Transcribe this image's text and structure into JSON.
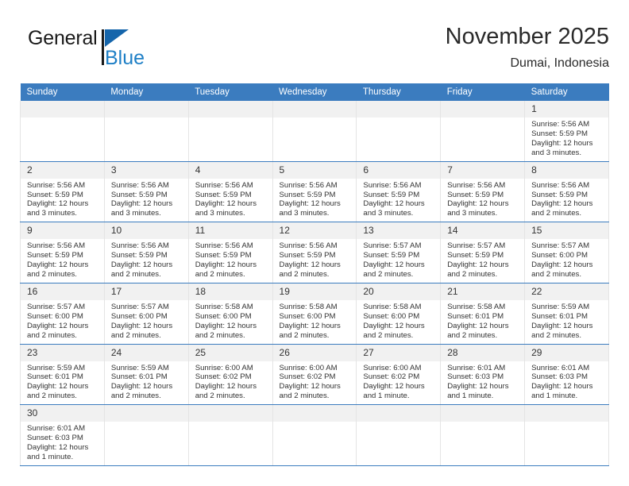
{
  "brand": {
    "name_top": "General",
    "name_bottom": "Blue",
    "accent_color": "#1e7fc6",
    "triangle_color": "#1565ab"
  },
  "header": {
    "title": "November 2025",
    "subtitle": "Dumai, Indonesia"
  },
  "theme": {
    "header_blue": "#3b7cbf",
    "daynum_band": "#f1f1f1",
    "cell_border": "#e4e4e4",
    "text": "#333333"
  },
  "weekdays": [
    "Sunday",
    "Monday",
    "Tuesday",
    "Wednesday",
    "Thursday",
    "Friday",
    "Saturday"
  ],
  "weeks": [
    [
      {
        "day": "",
        "sunrise": "",
        "sunset": "",
        "daylight": ""
      },
      {
        "day": "",
        "sunrise": "",
        "sunset": "",
        "daylight": ""
      },
      {
        "day": "",
        "sunrise": "",
        "sunset": "",
        "daylight": ""
      },
      {
        "day": "",
        "sunrise": "",
        "sunset": "",
        "daylight": ""
      },
      {
        "day": "",
        "sunrise": "",
        "sunset": "",
        "daylight": ""
      },
      {
        "day": "",
        "sunrise": "",
        "sunset": "",
        "daylight": ""
      },
      {
        "day": "1",
        "sunrise": "Sunrise: 5:56 AM",
        "sunset": "Sunset: 5:59 PM",
        "daylight": "Daylight: 12 hours and 3 minutes."
      }
    ],
    [
      {
        "day": "2",
        "sunrise": "Sunrise: 5:56 AM",
        "sunset": "Sunset: 5:59 PM",
        "daylight": "Daylight: 12 hours and 3 minutes."
      },
      {
        "day": "3",
        "sunrise": "Sunrise: 5:56 AM",
        "sunset": "Sunset: 5:59 PM",
        "daylight": "Daylight: 12 hours and 3 minutes."
      },
      {
        "day": "4",
        "sunrise": "Sunrise: 5:56 AM",
        "sunset": "Sunset: 5:59 PM",
        "daylight": "Daylight: 12 hours and 3 minutes."
      },
      {
        "day": "5",
        "sunrise": "Sunrise: 5:56 AM",
        "sunset": "Sunset: 5:59 PM",
        "daylight": "Daylight: 12 hours and 3 minutes."
      },
      {
        "day": "6",
        "sunrise": "Sunrise: 5:56 AM",
        "sunset": "Sunset: 5:59 PM",
        "daylight": "Daylight: 12 hours and 3 minutes."
      },
      {
        "day": "7",
        "sunrise": "Sunrise: 5:56 AM",
        "sunset": "Sunset: 5:59 PM",
        "daylight": "Daylight: 12 hours and 3 minutes."
      },
      {
        "day": "8",
        "sunrise": "Sunrise: 5:56 AM",
        "sunset": "Sunset: 5:59 PM",
        "daylight": "Daylight: 12 hours and 2 minutes."
      }
    ],
    [
      {
        "day": "9",
        "sunrise": "Sunrise: 5:56 AM",
        "sunset": "Sunset: 5:59 PM",
        "daylight": "Daylight: 12 hours and 2 minutes."
      },
      {
        "day": "10",
        "sunrise": "Sunrise: 5:56 AM",
        "sunset": "Sunset: 5:59 PM",
        "daylight": "Daylight: 12 hours and 2 minutes."
      },
      {
        "day": "11",
        "sunrise": "Sunrise: 5:56 AM",
        "sunset": "Sunset: 5:59 PM",
        "daylight": "Daylight: 12 hours and 2 minutes."
      },
      {
        "day": "12",
        "sunrise": "Sunrise: 5:56 AM",
        "sunset": "Sunset: 5:59 PM",
        "daylight": "Daylight: 12 hours and 2 minutes."
      },
      {
        "day": "13",
        "sunrise": "Sunrise: 5:57 AM",
        "sunset": "Sunset: 5:59 PM",
        "daylight": "Daylight: 12 hours and 2 minutes."
      },
      {
        "day": "14",
        "sunrise": "Sunrise: 5:57 AM",
        "sunset": "Sunset: 5:59 PM",
        "daylight": "Daylight: 12 hours and 2 minutes."
      },
      {
        "day": "15",
        "sunrise": "Sunrise: 5:57 AM",
        "sunset": "Sunset: 6:00 PM",
        "daylight": "Daylight: 12 hours and 2 minutes."
      }
    ],
    [
      {
        "day": "16",
        "sunrise": "Sunrise: 5:57 AM",
        "sunset": "Sunset: 6:00 PM",
        "daylight": "Daylight: 12 hours and 2 minutes."
      },
      {
        "day": "17",
        "sunrise": "Sunrise: 5:57 AM",
        "sunset": "Sunset: 6:00 PM",
        "daylight": "Daylight: 12 hours and 2 minutes."
      },
      {
        "day": "18",
        "sunrise": "Sunrise: 5:58 AM",
        "sunset": "Sunset: 6:00 PM",
        "daylight": "Daylight: 12 hours and 2 minutes."
      },
      {
        "day": "19",
        "sunrise": "Sunrise: 5:58 AM",
        "sunset": "Sunset: 6:00 PM",
        "daylight": "Daylight: 12 hours and 2 minutes."
      },
      {
        "day": "20",
        "sunrise": "Sunrise: 5:58 AM",
        "sunset": "Sunset: 6:00 PM",
        "daylight": "Daylight: 12 hours and 2 minutes."
      },
      {
        "day": "21",
        "sunrise": "Sunrise: 5:58 AM",
        "sunset": "Sunset: 6:01 PM",
        "daylight": "Daylight: 12 hours and 2 minutes."
      },
      {
        "day": "22",
        "sunrise": "Sunrise: 5:59 AM",
        "sunset": "Sunset: 6:01 PM",
        "daylight": "Daylight: 12 hours and 2 minutes."
      }
    ],
    [
      {
        "day": "23",
        "sunrise": "Sunrise: 5:59 AM",
        "sunset": "Sunset: 6:01 PM",
        "daylight": "Daylight: 12 hours and 2 minutes."
      },
      {
        "day": "24",
        "sunrise": "Sunrise: 5:59 AM",
        "sunset": "Sunset: 6:01 PM",
        "daylight": "Daylight: 12 hours and 2 minutes."
      },
      {
        "day": "25",
        "sunrise": "Sunrise: 6:00 AM",
        "sunset": "Sunset: 6:02 PM",
        "daylight": "Daylight: 12 hours and 2 minutes."
      },
      {
        "day": "26",
        "sunrise": "Sunrise: 6:00 AM",
        "sunset": "Sunset: 6:02 PM",
        "daylight": "Daylight: 12 hours and 2 minutes."
      },
      {
        "day": "27",
        "sunrise": "Sunrise: 6:00 AM",
        "sunset": "Sunset: 6:02 PM",
        "daylight": "Daylight: 12 hours and 1 minute."
      },
      {
        "day": "28",
        "sunrise": "Sunrise: 6:01 AM",
        "sunset": "Sunset: 6:03 PM",
        "daylight": "Daylight: 12 hours and 1 minute."
      },
      {
        "day": "29",
        "sunrise": "Sunrise: 6:01 AM",
        "sunset": "Sunset: 6:03 PM",
        "daylight": "Daylight: 12 hours and 1 minute."
      }
    ],
    [
      {
        "day": "30",
        "sunrise": "Sunrise: 6:01 AM",
        "sunset": "Sunset: 6:03 PM",
        "daylight": "Daylight: 12 hours and 1 minute."
      },
      {
        "day": "",
        "sunrise": "",
        "sunset": "",
        "daylight": ""
      },
      {
        "day": "",
        "sunrise": "",
        "sunset": "",
        "daylight": ""
      },
      {
        "day": "",
        "sunrise": "",
        "sunset": "",
        "daylight": ""
      },
      {
        "day": "",
        "sunrise": "",
        "sunset": "",
        "daylight": ""
      },
      {
        "day": "",
        "sunrise": "",
        "sunset": "",
        "daylight": ""
      },
      {
        "day": "",
        "sunrise": "",
        "sunset": "",
        "daylight": ""
      }
    ]
  ]
}
